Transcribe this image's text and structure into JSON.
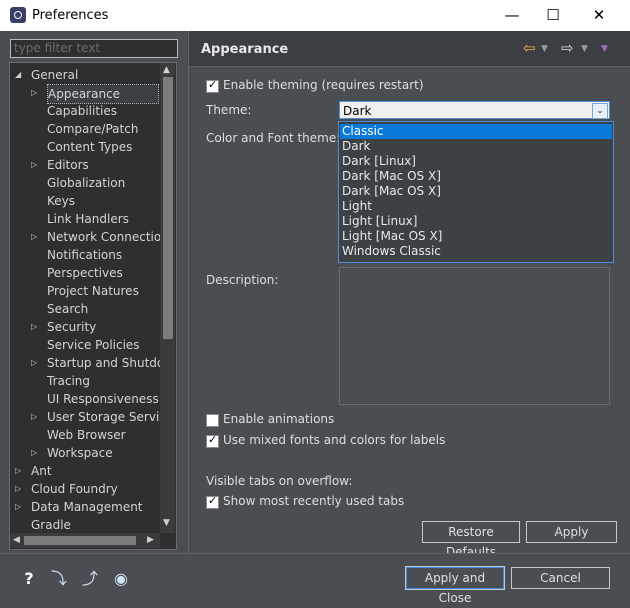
{
  "window": {
    "title": "Preferences",
    "minimize": "—",
    "maximize": "☐",
    "close": "✕"
  },
  "filter": {
    "placeholder": "type filter text"
  },
  "tree": {
    "items": [
      {
        "label": "General",
        "expanded": true
      },
      {
        "label": "Appearance",
        "selected": true
      },
      {
        "label": "Capabilities"
      },
      {
        "label": "Compare/Patch"
      },
      {
        "label": "Content Types"
      },
      {
        "label": "Editors"
      },
      {
        "label": "Globalization"
      },
      {
        "label": "Keys"
      },
      {
        "label": "Link Handlers"
      },
      {
        "label": "Network Connections"
      },
      {
        "label": "Notifications"
      },
      {
        "label": "Perspectives"
      },
      {
        "label": "Project Natures"
      },
      {
        "label": "Search"
      },
      {
        "label": "Security"
      },
      {
        "label": "Service Policies"
      },
      {
        "label": "Startup and Shutdown"
      },
      {
        "label": "Tracing"
      },
      {
        "label": "UI Responsiveness M"
      },
      {
        "label": "User Storage Service"
      },
      {
        "label": "Web Browser"
      },
      {
        "label": "Workspace"
      },
      {
        "label": "Ant"
      },
      {
        "label": "Cloud Foundry"
      },
      {
        "label": "Data Management"
      },
      {
        "label": "Gradle"
      }
    ]
  },
  "page": {
    "title": "Appearance",
    "enable_theming": "Enable theming (requires restart)",
    "theme_label": "Theme:",
    "theme_value": "Dark",
    "color_font_label": "Color and Font theme:",
    "theme_options": [
      "Classic",
      "Dark",
      "Dark [Linux]",
      "Dark [Mac OS X]",
      "Dark [Mac OS X]",
      "Light",
      "Light [Linux]",
      "Light [Mac OS X]",
      "Windows Classic"
    ],
    "description_label": "Description:",
    "enable_animations": "Enable animations",
    "mixed_fonts": "Use mixed fonts and colors for labels",
    "visible_tabs_label": "Visible tabs on overflow:",
    "show_recent_tabs": "Show most recently used tabs",
    "restore_defaults": "Restore Defaults",
    "apply": "Apply"
  },
  "footer": {
    "apply_close": "Apply and Close",
    "cancel": "Cancel"
  },
  "colors": {
    "accent": "#0a7ad8",
    "panel": "#4a4e52",
    "tree_bg": "#2e2f31"
  }
}
